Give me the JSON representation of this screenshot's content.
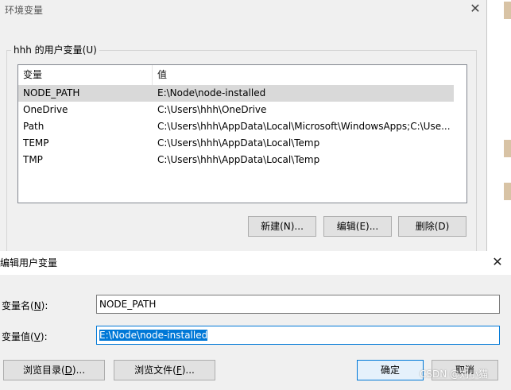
{
  "env_window": {
    "title": "环境变量",
    "close_glyph": "✕",
    "group_label": "hhh 的用户变量(U)",
    "columns": [
      "变量",
      "值"
    ],
    "rows": [
      {
        "name": "NODE_PATH",
        "value": "E:\\Node\\node-installed",
        "selected": true
      },
      {
        "name": "OneDrive",
        "value": "C:\\Users\\hhh\\OneDrive"
      },
      {
        "name": "Path",
        "value": "C:\\Users\\hhh\\AppData\\Local\\Microsoft\\WindowsApps;C:\\Use..."
      },
      {
        "name": "TEMP",
        "value": "C:\\Users\\hhh\\AppData\\Local\\Temp"
      },
      {
        "name": "TMP",
        "value": "C:\\Users\\hhh\\AppData\\Local\\Temp"
      }
    ],
    "buttons": {
      "new": "新建(N)...",
      "edit": "编辑(E)...",
      "delete": "删除(D)"
    }
  },
  "edit_dialog": {
    "title": "编辑用户变量",
    "close_glyph": "✕",
    "name_label_prefix": "变量名(",
    "name_label_key": "N",
    "name_label_suffix": "):",
    "value_label_prefix": "变量值(",
    "value_label_key": "V",
    "value_label_suffix": "):",
    "name_value": "NODE_PATH",
    "value_value": "E:\\Node\\node-installed",
    "browse_dir_prefix": "浏览目录(",
    "browse_dir_key": "D",
    "browse_dir_suffix": ")...",
    "browse_file_prefix": "浏览文件(",
    "browse_file_key": "F",
    "browse_file_suffix": ")...",
    "ok": "确定",
    "cancel": "取消"
  },
  "watermark": "CSDN @刘小猫"
}
